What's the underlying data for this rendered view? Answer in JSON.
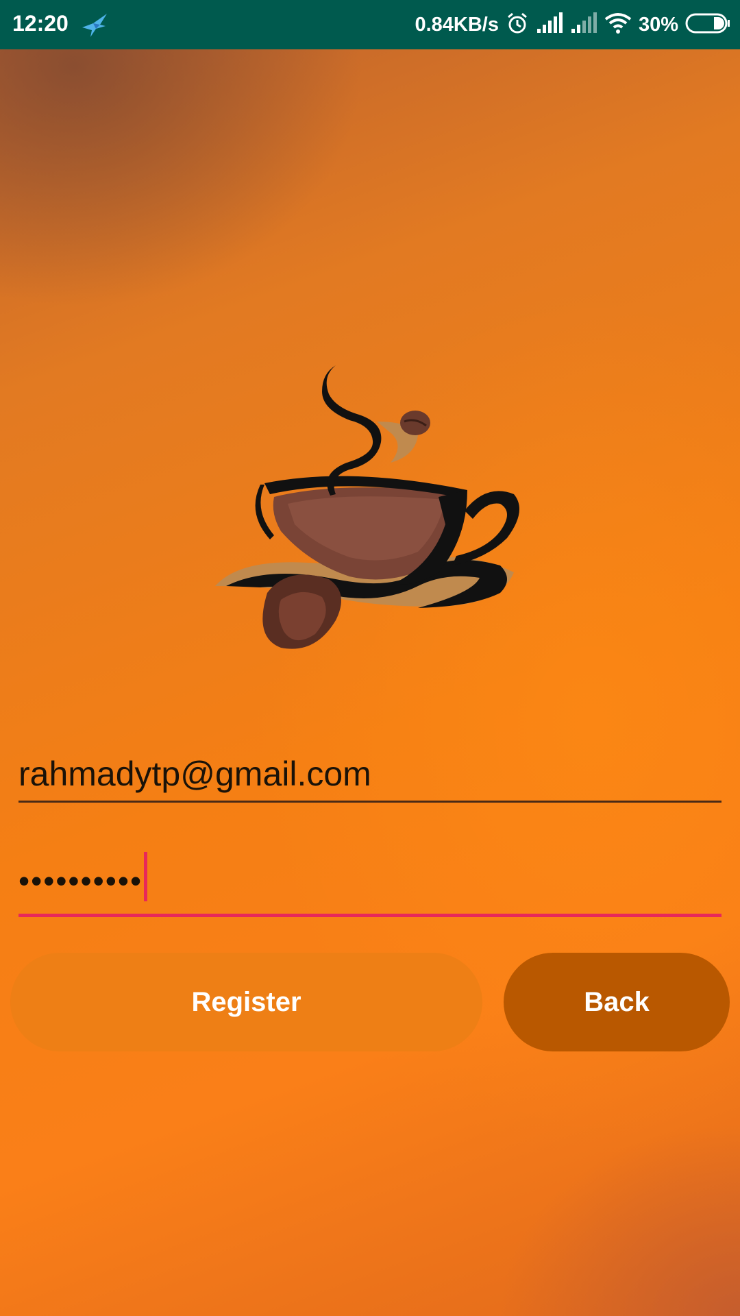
{
  "status_bar": {
    "time": "12:20",
    "network_speed": "0.84KB/s",
    "battery_percent": "30%",
    "battery_level": 0.3,
    "icons": [
      "bird-notification-icon",
      "alarm-icon",
      "signal-icon",
      "signal-icon-2",
      "wifi-icon",
      "battery-icon"
    ],
    "background_color": "#005a4e"
  },
  "logo": {
    "icon": "coffee-cup-logo"
  },
  "form": {
    "email_value": "rahmadytp@gmail.com",
    "password_value": "••••••••••",
    "password_focused": true,
    "accent_color": "#e8285a"
  },
  "buttons": {
    "register_label": "Register",
    "back_label": "Back",
    "register_color": "#ee7f15",
    "back_color": "#b95800"
  }
}
